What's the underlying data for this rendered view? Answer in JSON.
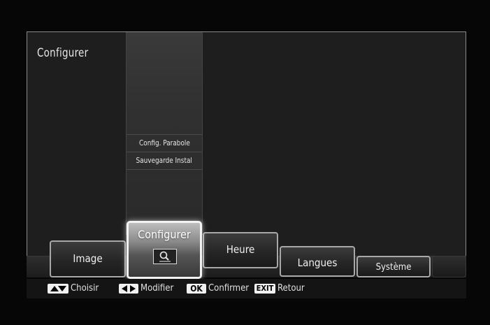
{
  "panel": {
    "title": "Configurer"
  },
  "submenu": {
    "items": [
      {
        "label": "Config. Parabole"
      },
      {
        "label": "Sauvegarde Instal"
      }
    ]
  },
  "tabs": [
    {
      "label": "Image"
    },
    {
      "label": "Configurer"
    },
    {
      "label": "Heure"
    },
    {
      "label": "Langues"
    },
    {
      "label": "Système"
    }
  ],
  "hints": [
    {
      "key": "up-down",
      "label": "Choisir"
    },
    {
      "key": "left-right",
      "label": "Modifier"
    },
    {
      "key": "OK",
      "label": "Confirmer"
    },
    {
      "key": "EXIT",
      "label": "Retour"
    }
  ],
  "icons": {
    "active_tab_icon": "magnifier-icon"
  }
}
